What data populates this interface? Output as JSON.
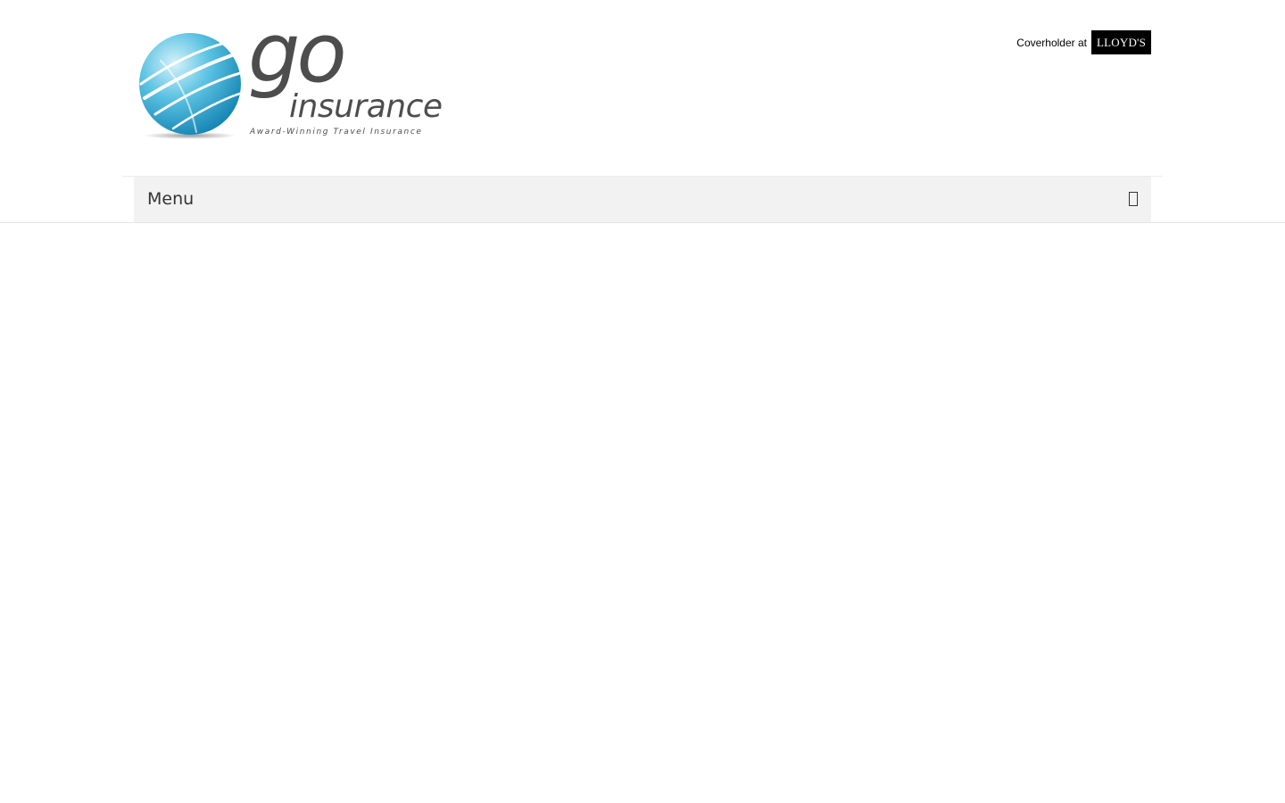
{
  "header": {
    "logo": {
      "brand_word": "go",
      "brand_sub": "insurance",
      "tagline": "Award-Winning Travel Insurance",
      "colors": {
        "globe_light": "#9fdcf0",
        "globe_dark": "#1a8fbf",
        "text": "#4d4d4d"
      }
    },
    "lloyds": {
      "prefix": "Coverholder at",
      "badge": "LLOYD'S"
    }
  },
  "nav": {
    "menu_label": "Menu",
    "menu_icon": "toggle-icon"
  },
  "colors": {
    "menu_bg": "#f2f2f2",
    "menu_text": "#333333",
    "badge_bg": "#000000"
  }
}
